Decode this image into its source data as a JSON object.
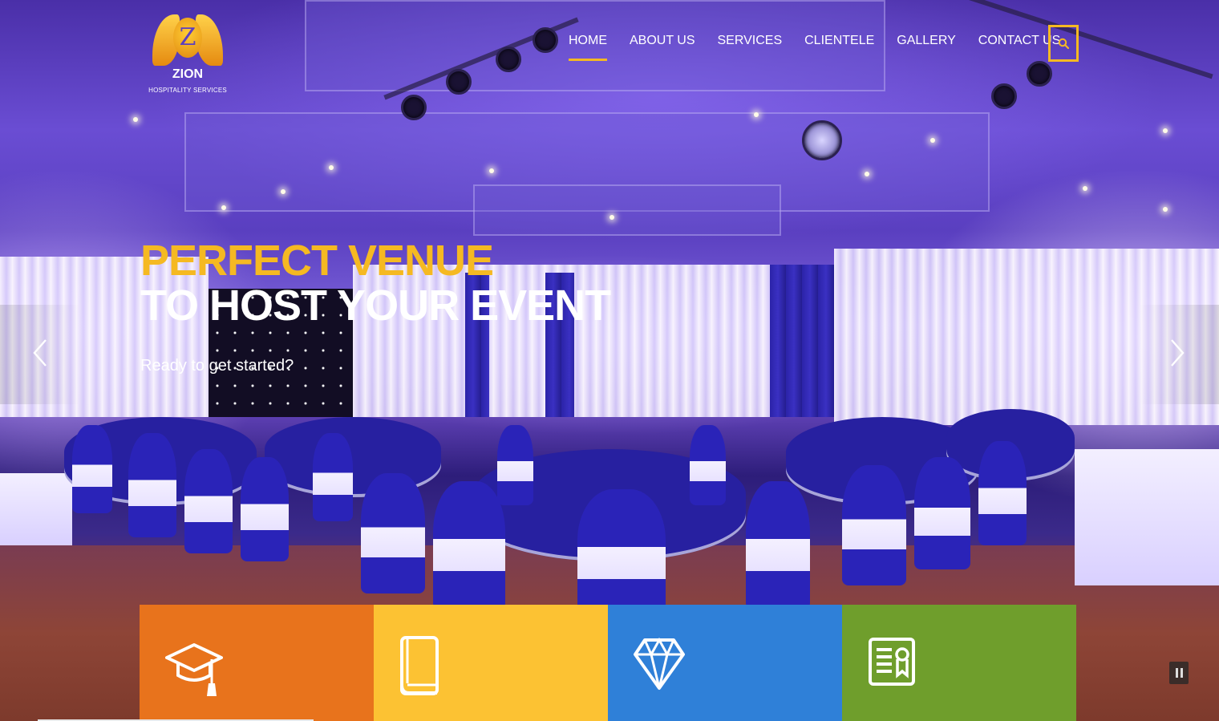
{
  "brand": {
    "logo_letter": "Z",
    "name": "ZION",
    "tagline": "HOSPITALITY SERVICES"
  },
  "nav": {
    "items": [
      "HOME",
      "ABOUT US",
      "SERVICES",
      "CLIENTELE",
      "GALLERY",
      "CONTACT US"
    ],
    "active": "HOME"
  },
  "slide": {
    "headline_line1": "PERFECT VENUE",
    "headline_line2": "TO HOST YOUR EVENT",
    "subline": "Ready to get started?"
  },
  "icons": {
    "search": "search-icon",
    "prev": "chevron-left-icon",
    "next": "chevron-right-icon",
    "pause": "pause-icon",
    "features": [
      "graduation-cap-icon",
      "book-icon",
      "diamond-icon",
      "certificate-icon"
    ]
  },
  "colors": {
    "accent": "#f5b922",
    "feature_boxes": [
      "#e8731c",
      "#fcc233",
      "#2f80d8",
      "#6f9e2c"
    ]
  }
}
